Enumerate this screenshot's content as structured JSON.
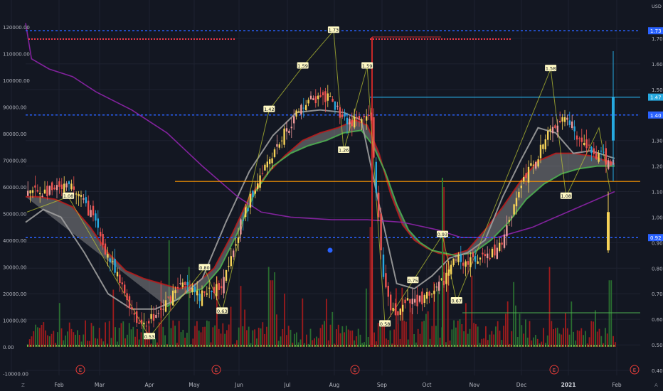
{
  "currency": "USD",
  "corner_left": "Z",
  "corner_right": "A",
  "colors": {
    "background": "#131722",
    "bull": "#f7d358",
    "bull_alt": "#ef9a9a",
    "bear": "#ef5350",
    "cyan": "#26a9e0",
    "ribbon_fill": "#9e9e9e",
    "green": "#4caf50",
    "maroon": "#b71c1c",
    "purple": "#8e24aa",
    "orange": "#ff9800",
    "blue_dotted": "#2962ff",
    "red_dotted": "#f23645",
    "axis_text": "#b2b5be"
  },
  "left_axis": {
    "labels": [
      "120000.00",
      "110000.00",
      "100000.00",
      "90000.00",
      "80000.00",
      "70000.00",
      "60000.00",
      "50000.00",
      "40000.00",
      "30000.00",
      "20000.00",
      "10000.00",
      "0.00",
      "-10000.00"
    ]
  },
  "right_axis": {
    "labels": [
      "1.70",
      "1.60",
      "1.50",
      "1.40",
      "1.30",
      "1.20",
      "1.10",
      "1.00",
      "0.90",
      "0.80",
      "0.70",
      "0.60",
      "0.50",
      "0.40"
    ],
    "highlights": [
      {
        "label": "1.73",
        "value": 1.73,
        "color": "#2962ff"
      },
      {
        "label": "1.47",
        "value": 1.47,
        "color": "#26a9e0"
      },
      {
        "label": "1.40",
        "value": 1.4,
        "color": "#2962ff"
      },
      {
        "label": "0.92",
        "value": 0.92,
        "color": "#2962ff"
      }
    ]
  },
  "x_axis": {
    "labels": [
      "Feb",
      "Mar",
      "Apr",
      "May",
      "Jun",
      "Jul",
      "Aug",
      "Sep",
      "Oct",
      "Nov",
      "Dec",
      "2021",
      "Feb"
    ]
  },
  "event_markers": {
    "label": "E",
    "dates": [
      "Feb-20",
      "May-28",
      "Aug-25",
      "Dec-09",
      "Feb-15"
    ]
  },
  "chart_data": {
    "type": "candlestick",
    "price_unit": "USD",
    "price_range": [
      0.4,
      1.76
    ],
    "volume_range": [
      -10000,
      125000
    ],
    "key_levels": [
      {
        "price": 1.73,
        "style": "dotted",
        "color": "#2962ff"
      },
      {
        "price": 1.4,
        "style": "dotted",
        "color": "#2962ff"
      },
      {
        "price": 0.92,
        "style": "dotted",
        "color": "#2962ff"
      },
      {
        "price": 1.14,
        "style": "solid",
        "color": "#ff9800"
      },
      {
        "price": 1.47,
        "style": "solid",
        "color": "#26a9e0"
      }
    ],
    "anchors": [
      {
        "date": "Jan-27",
        "price": 1.1
      },
      {
        "date": "Feb-10",
        "price": 1.12
      },
      {
        "date": "Feb-24",
        "price": 1.02
      },
      {
        "date": "Mar-10",
        "price": 0.78
      },
      {
        "date": "Mar-25",
        "price": 0.58
      },
      {
        "date": "Apr-07",
        "price": 0.62
      },
      {
        "date": "Apr-20",
        "price": 0.74
      },
      {
        "date": "May-04",
        "price": 0.69
      },
      {
        "date": "May-18",
        "price": 0.73
      },
      {
        "date": "Jun-01",
        "price": 0.96
      },
      {
        "date": "Jun-15",
        "price": 1.19
      },
      {
        "date": "Jun-29",
        "price": 1.33
      },
      {
        "date": "Jul-13",
        "price": 1.46
      },
      {
        "date": "Jul-27",
        "price": 1.46
      },
      {
        "date": "Aug-10",
        "price": 1.37
      },
      {
        "date": "Aug-24",
        "price": 1.38
      },
      {
        "date": "Sep-01",
        "price": 0.75
      },
      {
        "date": "Sep-07",
        "price": 0.62
      },
      {
        "date": "Sep-21",
        "price": 0.67
      },
      {
        "date": "Oct-05",
        "price": 0.69
      },
      {
        "date": "Oct-19",
        "price": 0.84
      },
      {
        "date": "Nov-02",
        "price": 0.82
      },
      {
        "date": "Nov-16",
        "price": 0.87
      },
      {
        "date": "Nov-30",
        "price": 1.12
      },
      {
        "date": "Dec-14",
        "price": 1.28
      },
      {
        "date": "Dec-28",
        "price": 1.42
      },
      {
        "date": "Jan-11",
        "price": 1.27
      },
      {
        "date": "Jan-25",
        "price": 1.22
      },
      {
        "date": "Feb-03",
        "price": 1.21
      },
      {
        "date": "Feb-08",
        "price": 1.47
      }
    ],
    "pivot_labels": [
      {
        "text": "1.08",
        "date": "Feb-08",
        "price": 1.08
      },
      {
        "text": "0.53",
        "date": "Apr-01",
        "price": 0.53
      },
      {
        "text": "0.80",
        "date": "May-08",
        "price": 0.8
      },
      {
        "text": "0.63",
        "date": "May-20",
        "price": 0.63
      },
      {
        "text": "1.42",
        "date": "Jun-20",
        "price": 1.42
      },
      {
        "text": "1.59",
        "date": "Jul-11",
        "price": 1.59
      },
      {
        "text": "1.73",
        "date": "Jul-31",
        "price": 1.73
      },
      {
        "text": "1.26",
        "date": "Aug-07",
        "price": 1.26
      },
      {
        "text": "1.59",
        "date": "Aug-22",
        "price": 1.59
      },
      {
        "text": "0.58",
        "date": "Sep-03",
        "price": 0.58
      },
      {
        "text": "0.75",
        "date": "Sep-22",
        "price": 0.75
      },
      {
        "text": "0.93",
        "date": "Oct-11",
        "price": 0.93
      },
      {
        "text": "0.67",
        "date": "Oct-20",
        "price": 0.67
      },
      {
        "text": "1.58",
        "date": "Dec-20",
        "price": 1.58
      },
      {
        "text": "1.08",
        "date": "Dec-30",
        "price": 1.08
      }
    ],
    "moving_averages": [
      {
        "color": "#b71c1c",
        "points": [
          [
            0,
            1.08
          ],
          [
            0.02,
            1.08
          ],
          [
            0.05,
            1.07
          ],
          [
            0.08,
            1.04
          ],
          [
            0.11,
            0.96
          ],
          [
            0.14,
            0.86
          ],
          [
            0.17,
            0.79
          ],
          [
            0.2,
            0.76
          ],
          [
            0.23,
            0.74
          ],
          [
            0.26,
            0.72
          ],
          [
            0.29,
            0.74
          ],
          [
            0.32,
            0.8
          ],
          [
            0.35,
            0.93
          ],
          [
            0.38,
            1.08
          ],
          [
            0.41,
            1.17
          ],
          [
            0.44,
            1.24
          ],
          [
            0.47,
            1.3
          ],
          [
            0.5,
            1.33
          ],
          [
            0.53,
            1.35
          ],
          [
            0.56,
            1.38
          ],
          [
            0.58,
            1.36
          ],
          [
            0.6,
            1.25
          ],
          [
            0.62,
            1.09
          ],
          [
            0.64,
            0.97
          ],
          [
            0.66,
            0.91
          ],
          [
            0.68,
            0.88
          ],
          [
            0.7,
            0.86
          ],
          [
            0.72,
            0.85
          ],
          [
            0.75,
            0.87
          ],
          [
            0.78,
            0.95
          ],
          [
            0.81,
            1.04
          ],
          [
            0.84,
            1.14
          ],
          [
            0.87,
            1.22
          ],
          [
            0.9,
            1.25
          ],
          [
            0.93,
            1.25
          ],
          [
            0.96,
            1.24
          ],
          [
            1.0,
            1.21
          ]
        ]
      },
      {
        "color": "#4caf50",
        "points": [
          [
            0.24,
            0.65
          ],
          [
            0.27,
            0.7
          ],
          [
            0.3,
            0.72
          ],
          [
            0.33,
            0.8
          ],
          [
            0.36,
            0.94
          ],
          [
            0.39,
            1.1
          ],
          [
            0.42,
            1.2
          ],
          [
            0.45,
            1.25
          ],
          [
            0.48,
            1.28
          ],
          [
            0.51,
            1.3
          ],
          [
            0.54,
            1.33
          ],
          [
            0.57,
            1.34
          ],
          [
            0.59,
            1.28
          ],
          [
            0.61,
            1.18
          ],
          [
            0.63,
            1.05
          ],
          [
            0.65,
            0.95
          ],
          [
            0.67,
            0.9
          ],
          [
            0.69,
            0.87
          ],
          [
            0.71,
            0.86
          ],
          [
            0.73,
            0.85
          ],
          [
            0.76,
            0.86
          ],
          [
            0.79,
            0.91
          ],
          [
            0.82,
            0.98
          ],
          [
            0.85,
            1.07
          ],
          [
            0.88,
            1.13
          ],
          [
            0.91,
            1.17
          ],
          [
            0.94,
            1.19
          ],
          [
            0.97,
            1.2
          ],
          [
            1.0,
            1.2
          ]
        ]
      },
      {
        "color": "#9e9e9e",
        "points": [
          [
            0,
            0.98
          ],
          [
            0.03,
            1.03
          ],
          [
            0.06,
            1.0
          ],
          [
            0.1,
            0.86
          ],
          [
            0.14,
            0.7
          ],
          [
            0.18,
            0.64
          ],
          [
            0.22,
            0.64
          ],
          [
            0.26,
            0.68
          ],
          [
            0.3,
            0.76
          ],
          [
            0.34,
            0.98
          ],
          [
            0.38,
            1.18
          ],
          [
            0.42,
            1.32
          ],
          [
            0.46,
            1.41
          ],
          [
            0.5,
            1.42
          ],
          [
            0.54,
            1.41
          ],
          [
            0.57,
            1.38
          ],
          [
            0.6,
            1.05
          ],
          [
            0.63,
            0.74
          ],
          [
            0.66,
            0.72
          ],
          [
            0.69,
            0.77
          ],
          [
            0.72,
            0.84
          ],
          [
            0.75,
            0.86
          ],
          [
            0.78,
            0.91
          ],
          [
            0.81,
            1.08
          ],
          [
            0.84,
            1.22
          ],
          [
            0.87,
            1.35
          ],
          [
            0.9,
            1.33
          ],
          [
            0.93,
            1.25
          ],
          [
            0.96,
            1.26
          ],
          [
            1.0,
            1.23
          ]
        ]
      },
      {
        "color": "#8e24aa",
        "points": [
          [
            0,
            1.76
          ],
          [
            0.01,
            1.62
          ],
          [
            0.04,
            1.58
          ],
          [
            0.08,
            1.55
          ],
          [
            0.12,
            1.49
          ],
          [
            0.18,
            1.42
          ],
          [
            0.24,
            1.33
          ],
          [
            0.3,
            1.2
          ],
          [
            0.36,
            1.08
          ],
          [
            0.4,
            1.02
          ],
          [
            0.45,
            1.0
          ],
          [
            0.52,
            0.99
          ],
          [
            0.58,
            0.99
          ],
          [
            0.64,
            0.98
          ],
          [
            0.7,
            0.95
          ],
          [
            0.74,
            0.92
          ],
          [
            0.8,
            0.92
          ],
          [
            0.86,
            0.96
          ],
          [
            0.92,
            1.02
          ],
          [
            0.98,
            1.08
          ],
          [
            1.0,
            1.1
          ]
        ]
      }
    ],
    "volume_note": "monthly volume bars coloured green (up) / red (down)"
  }
}
